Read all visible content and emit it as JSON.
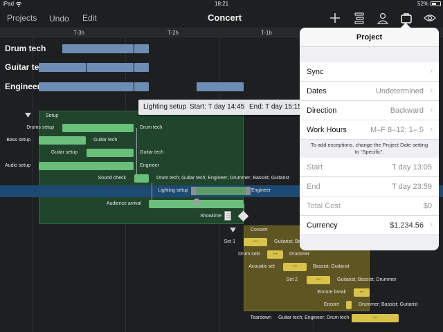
{
  "status": {
    "device": "iPad",
    "time": "18:21",
    "battery": "52%"
  },
  "nav": {
    "projects": "Projects",
    "undo": "Undo",
    "edit": "Edit",
    "title": "Concert"
  },
  "timeline": {
    "ticks": [
      "T-3h",
      "T-2h",
      "T-1h"
    ]
  },
  "resources": [
    "Drum tech",
    "Guitar tech",
    "Engineer"
  ],
  "tooltip": {
    "title": "Lighting setup",
    "start": "Start: T day 14:45",
    "end": "End: T day 15:15"
  },
  "setup_group": {
    "title": "Setup",
    "tasks": [
      {
        "name": "Drums setup",
        "res": "Drum tech"
      },
      {
        "name": "Bass setup",
        "res": "Guitar tech"
      },
      {
        "name": "Guitar setup",
        "res": "Guitar tech"
      },
      {
        "name": "Audio setup",
        "res": "Engineer"
      },
      {
        "name": "Sound check",
        "res": "Drum tech; Guitar tech; Engineer; Drummer; Bassist; Guitarist"
      },
      {
        "name": "Lighting setup",
        "res": "Engineer"
      },
      {
        "name": "Audience arrival",
        "res": ""
      },
      {
        "name": "Showtime",
        "res": ""
      }
    ]
  },
  "concert_group": {
    "title": "Concert",
    "tasks": [
      {
        "name": "Set 1",
        "res": "Guitarist; Bass"
      },
      {
        "name": "Drum solo",
        "res": "Drummer"
      },
      {
        "name": "Acoustic set",
        "res": "Bassist; Guitarist"
      },
      {
        "name": "Set 2",
        "res": "Guitarist; Bassist; Drummer"
      },
      {
        "name": "Encore break",
        "res": ""
      },
      {
        "name": "Encore",
        "res": "Drummer; Bassist; Guitarist"
      },
      {
        "name": "Teardown",
        "res": "Guitar tech; Engineer; Drum tech"
      }
    ],
    "bar_glyph": "•••"
  },
  "popover": {
    "title": "Project",
    "rows": [
      {
        "label": "Sync",
        "value": ""
      },
      {
        "label": "Dates",
        "value": "Undetermined"
      },
      {
        "label": "Direction",
        "value": "Backward"
      },
      {
        "label": "Work Hours",
        "value": "M–F 8–12; 1– 5"
      }
    ],
    "note": "To add exceptions, change the Project Date setting to “Specific”.",
    "info": [
      {
        "label": "Start",
        "value": "T day 13:05"
      },
      {
        "label": "End",
        "value": "T day 23:59"
      },
      {
        "label": "Total Cost",
        "value": "$0"
      }
    ],
    "currency": {
      "label": "Currency",
      "value": "$1,234.56"
    }
  },
  "colors": {
    "setup_bar": "#6abf7b",
    "concert_bar": "#d8c24c",
    "resource_bar": "#6d8db5",
    "popover_bg": "#efeff4"
  }
}
